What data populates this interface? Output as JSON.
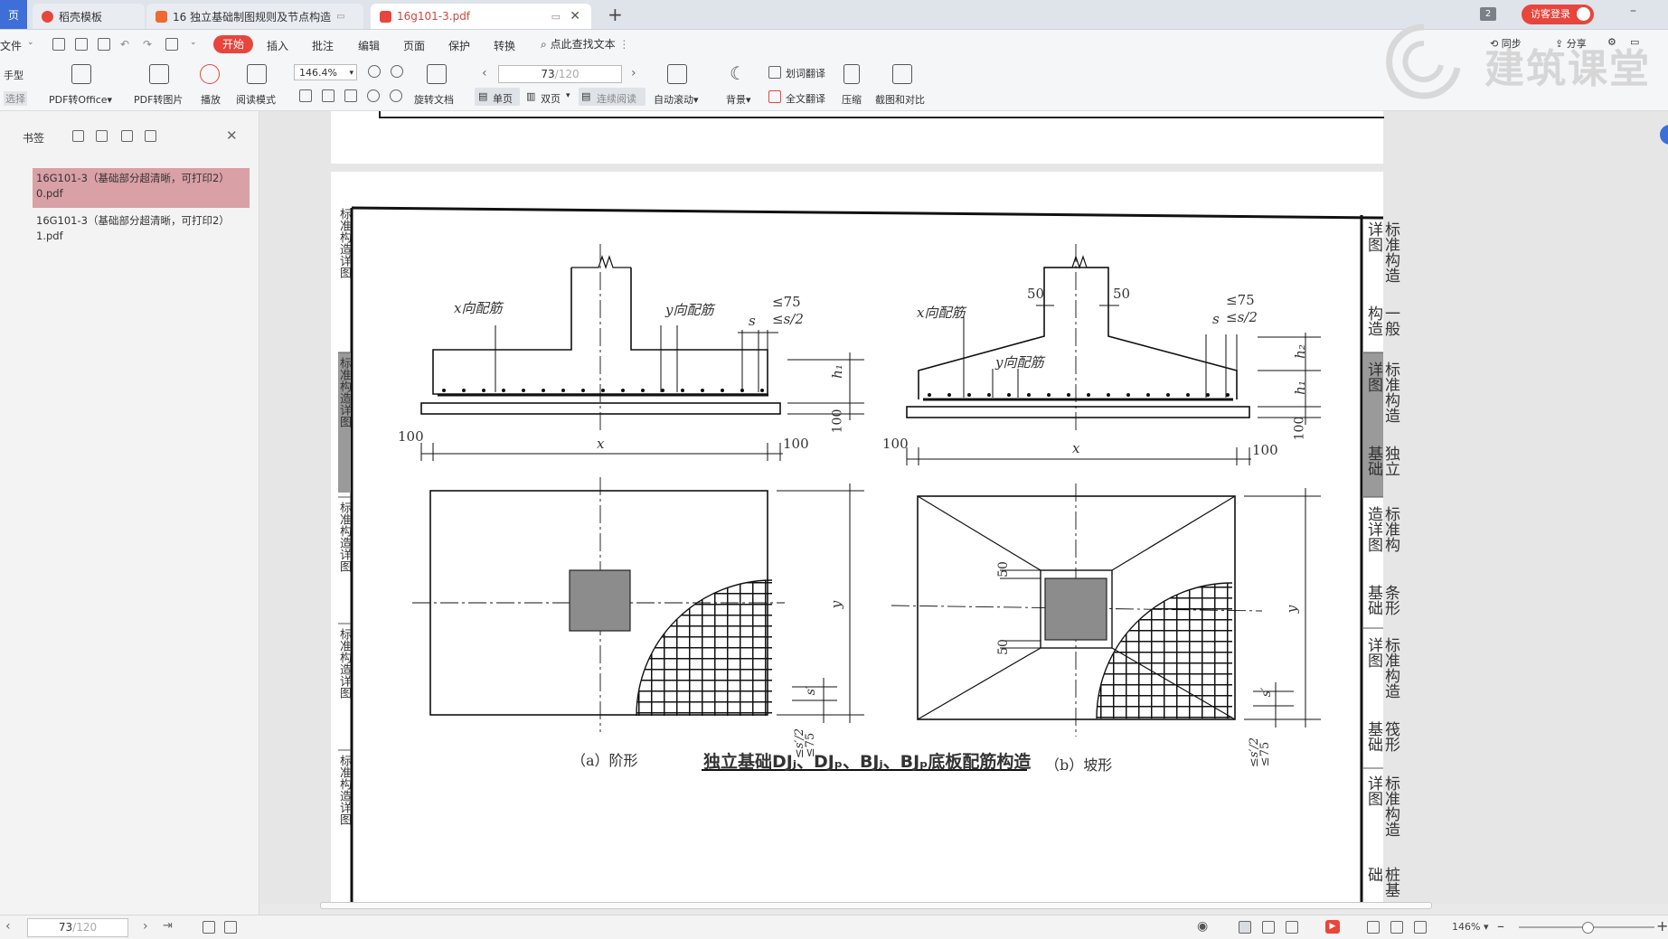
{
  "tabs": [
    {
      "label": "页",
      "active": false
    },
    {
      "label": "稻壳模板",
      "active": false
    },
    {
      "label": "16 独立基础制图规则及节点构造",
      "active": false
    },
    {
      "label": "16g101-3.pdf",
      "active": true
    }
  ],
  "tab_counter": "2",
  "login_label": "访客登录",
  "menu": [
    "文件",
    "开始",
    "插入",
    "批注",
    "编辑",
    "页面",
    "保护",
    "转换"
  ],
  "search_placeholder": "点此查找文本",
  "ribbon": {
    "hand": "手型",
    "select": "选择",
    "pdf_to_office": "PDF转Office",
    "pdf_to_image": "PDF转图片",
    "play": "播放",
    "read_mode": "阅读模式",
    "zoom": "146.4%",
    "rotate": "旋转文档",
    "single": "单页",
    "double": "双页",
    "continuous": "连续阅读",
    "page_current": "73",
    "page_total": "/120",
    "auto_scroll": "自动滚动",
    "background": "背景",
    "word_translate": "划词翻译",
    "full_translate": "全文翻译",
    "compress": "压缩",
    "screenshot_compare": "截图和对比",
    "sync": "同步",
    "share": "分享"
  },
  "sidebar": {
    "title": "书签",
    "items": [
      {
        "label": "16G101-3（基础部分超清晰，可打印2）0.pdf",
        "selected": true
      },
      {
        "label": "16G101-3（基础部分超清晰，可打印2）1.pdf",
        "selected": false
      }
    ]
  },
  "watermark": "建筑课堂",
  "drawing": {
    "left_tabs": [
      "标准构造详图",
      "标准构造详图",
      "标准构造详图",
      "标准构造详图",
      "标准构造详图"
    ],
    "right_tabs": [
      {
        "a": "标准构造详图",
        "b": "一般构造"
      },
      {
        "a": "标准构造详图",
        "b": "独立基础"
      },
      {
        "a": "标准构造详图",
        "b": "条形基础"
      },
      {
        "a": "标准构造详图",
        "b": "筏形基础"
      },
      {
        "a": "标准构造详图",
        "b": "桩基础"
      }
    ],
    "fig_a": {
      "x_rebar": "x向配筋",
      "y_rebar": "y向配筋",
      "le75": "≤75",
      "les2": "≤s/2",
      "s": "s",
      "h1": "h₁",
      "d100": "100",
      "x": "x",
      "y": "y",
      "sp": "s′",
      "sp2": "≤s′/2",
      "sp75": "≤75",
      "caption": "（a）阶形"
    },
    "fig_b": {
      "x_rebar": "x向配筋",
      "y_rebar": "y向配筋",
      "d50": "50",
      "le75": "≤75",
      "les2": "≤s/2",
      "s": "s",
      "h1": "h₁",
      "h2": "h₂",
      "d100": "100",
      "x": "x",
      "y": "y",
      "sp": "s′",
      "sp2": "≤s′/2",
      "sp75": "≤75",
      "caption": "（b）坡形"
    },
    "title": "独立基础DJⱼ、DJₚ、BJⱼ、BJₚ底板配筋构造"
  },
  "status": {
    "page_current": "73",
    "page_total": "/120",
    "zoom": "146%"
  },
  "colors": {
    "accent": "#e8453c",
    "selected_bookmark": "#d9a0a6",
    "section_tab": "#8a8a8a"
  }
}
